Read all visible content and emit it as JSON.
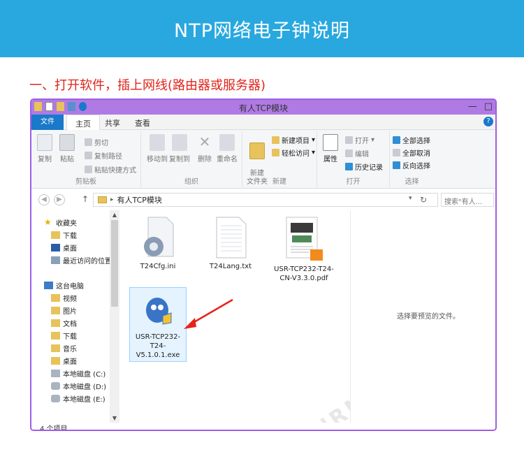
{
  "banner": {
    "title": "NTP网络电子钟说明"
  },
  "step": {
    "heading": "一、打开软件，插上网线(路由器或服务器)"
  },
  "window": {
    "title": "有人TCP模块",
    "controls": {
      "minimize": "—",
      "maximize": "□",
      "close": "✕"
    }
  },
  "tabs": {
    "file": "文件",
    "home": "主页",
    "share": "共享",
    "view": "查看",
    "help": "?"
  },
  "ribbon": {
    "clipboard": {
      "label": "剪贴板",
      "copy": "复制",
      "paste": "粘贴",
      "cut": "剪切",
      "copy_path": "复制路径",
      "paste_shortcut": "粘贴快捷方式"
    },
    "organize": {
      "label": "组织",
      "move_to": "移动到",
      "copy_to": "复制到",
      "delete": "删除",
      "rename": "重命名"
    },
    "new": {
      "label": "新建",
      "new_folder": "新建\n文件夹",
      "new_item": "新建项目",
      "easy_access": "轻松访问"
    },
    "open": {
      "label": "打开",
      "properties": "属性",
      "open": "打开",
      "edit": "编辑",
      "history": "历史记录"
    },
    "select": {
      "label": "选择",
      "select_all": "全部选择",
      "select_none": "全部取消",
      "invert": "反向选择"
    }
  },
  "address": {
    "path": "有人TCP模块",
    "search_placeholder": "搜索\"有人...",
    "up": "↑",
    "back": "◀",
    "forward": "▶",
    "refresh": "↻",
    "dropdown": "▾"
  },
  "nav": {
    "favorites": "收藏夹",
    "downloads": "下载",
    "desktop": "桌面",
    "recent": "最近访问的位置",
    "this_pc": "这台电脑",
    "videos": "视频",
    "pictures": "图片",
    "documents": "文档",
    "downloads2": "下载",
    "music": "音乐",
    "desktop2": "桌面",
    "disk_c": "本地磁盘 (C:)",
    "disk_d": "本地磁盘 (D:)",
    "disk_e": "本地磁盘 (E:)"
  },
  "files": [
    {
      "name": "T24Cfg.ini"
    },
    {
      "name": "T24Lang.txt"
    },
    {
      "name": "USR-TCP232-T24-CN-V3.3.0.pdf"
    },
    {
      "name": "USR-TCP232-T24-V5.1.0.1.exe"
    }
  ],
  "preview": {
    "message": "选择要预览的文件。"
  },
  "status": {
    "count": "4 个项目"
  },
  "colors": {
    "banner": "#29a8e0",
    "heading": "#e2231a",
    "window_border": "#a25de2",
    "arrow": "#e8231b"
  }
}
